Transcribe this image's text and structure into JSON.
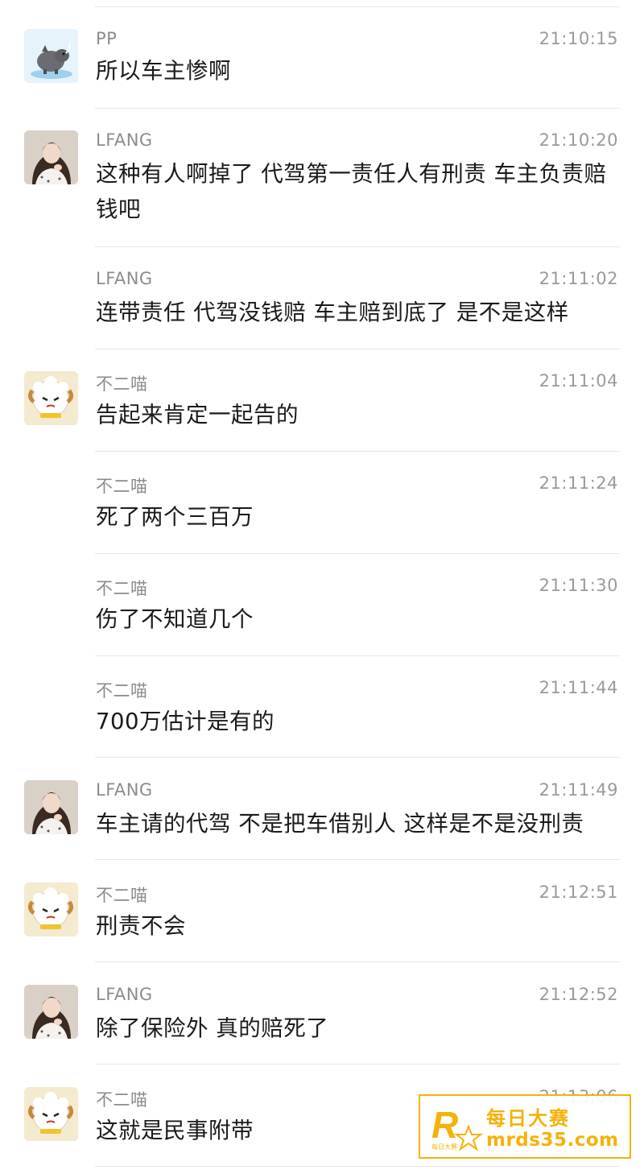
{
  "messages": [
    {
      "sender": "PP",
      "time": "21:10:15",
      "text": "所以车主惨啊",
      "avatar": "boar-avatar"
    },
    {
      "sender": "LFANG",
      "time": "21:10:20",
      "text": "这种有人啊掉了  代驾第一责任人有刑责 车主负责赔钱吧",
      "avatar": "girl-avatar"
    },
    {
      "sender": "LFANG",
      "time": "21:11:02",
      "text": "连带责任 代驾没钱赔 车主赔到底了 是不是这样",
      "avatar": ""
    },
    {
      "sender": "不二喵",
      "time": "21:11:04",
      "text": "告起来肯定一起告的",
      "avatar": "sheep-avatar"
    },
    {
      "sender": "不二喵",
      "time": "21:11:24",
      "text": "死了两个三百万",
      "avatar": ""
    },
    {
      "sender": "不二喵",
      "time": "21:11:30",
      "text": "伤了不知道几个",
      "avatar": ""
    },
    {
      "sender": "不二喵",
      "time": "21:11:44",
      "text": "700万估计是有的",
      "avatar": ""
    },
    {
      "sender": "LFANG",
      "time": "21:11:49",
      "text": "车主请的代驾 不是把车借别人 这样是不是没刑责",
      "avatar": "girl-avatar"
    },
    {
      "sender": "不二喵",
      "time": "21:12:51",
      "text": "刑责不会",
      "avatar": "sheep-avatar"
    },
    {
      "sender": "LFANG",
      "time": "21:12:52",
      "text": "除了保险外 真的赔死了",
      "avatar": "girl-avatar"
    },
    {
      "sender": "不二喵",
      "time": "21:13:06",
      "text": "这就是民事附带",
      "avatar": "sheep-avatar"
    }
  ],
  "watermark": {
    "title": "每日大赛",
    "url": "mrds35.com",
    "logo_text": "每日大赛",
    "accent": "#f4b20a"
  },
  "colors": {
    "sender": "#8c8c8c",
    "time": "#9a9a9a",
    "text": "#1a1a1a",
    "divider": "#e6e6e6"
  }
}
